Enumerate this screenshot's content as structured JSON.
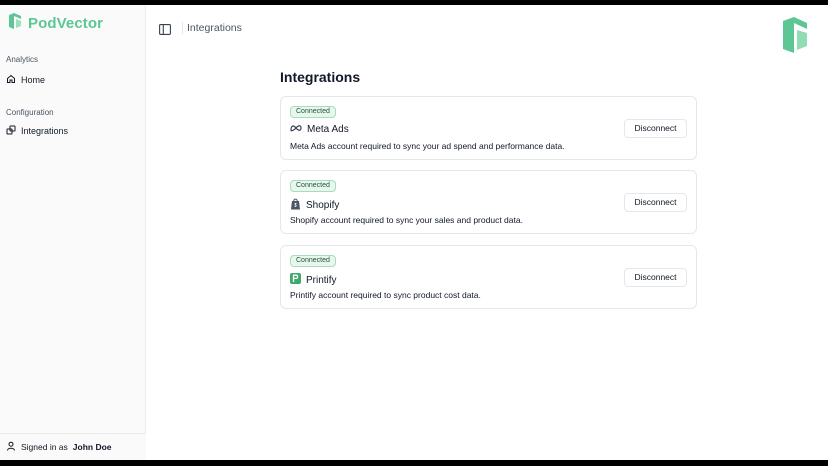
{
  "app": {
    "name": "PodVector",
    "brand_color": "#5cc795"
  },
  "sidebar": {
    "sections": [
      {
        "label": "Analytics",
        "items": [
          {
            "label": "Home",
            "icon": "home-icon"
          }
        ]
      },
      {
        "label": "Configuration",
        "items": [
          {
            "label": "Integrations",
            "icon": "integrations-icon"
          }
        ]
      }
    ],
    "signed_in_prefix": "Signed in as",
    "user_name": "John Doe"
  },
  "topbar": {
    "breadcrumb": "Integrations"
  },
  "main": {
    "title": "Integrations",
    "integrations": [
      {
        "status": "Connected",
        "name": "Meta Ads",
        "icon": "meta-icon",
        "description": "Meta Ads account required to sync your ad spend and performance data.",
        "action": "Disconnect"
      },
      {
        "status": "Connected",
        "name": "Shopify",
        "icon": "shopify-icon",
        "description": "Shopify account required to sync your sales and product data.",
        "action": "Disconnect"
      },
      {
        "status": "Connected",
        "name": "Printify",
        "icon": "printify-icon",
        "description": "Printify account required to sync product cost data.",
        "action": "Disconnect"
      }
    ]
  }
}
